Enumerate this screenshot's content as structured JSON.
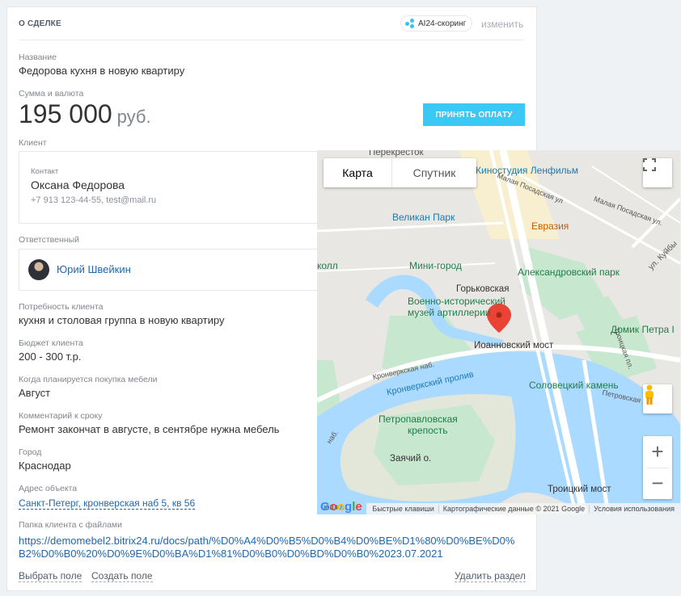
{
  "section": {
    "title": "О СДЕЛКЕ",
    "ai_badge": "AI24-скоринг",
    "edit_link": "изменить"
  },
  "deal": {
    "name_label": "Название",
    "name_value": "Федорова кухня в новую квартиру",
    "amount_label": "Сумма и валюта",
    "amount_value": "195 000",
    "currency": "руб.",
    "pay_button": "ПРИНЯТЬ ОПЛАТУ"
  },
  "client": {
    "label": "Клиент",
    "contact_label": "Контакт",
    "contact_name": "Оксана Федорова",
    "contact_info": "+7 913 123-44-55, test@mail.ru"
  },
  "responsible": {
    "label": "Ответственный",
    "name": "Юрий Швейкин"
  },
  "fields": [
    {
      "label": "Потребность клиента",
      "value": "кухня и столовая группа в новую квартиру"
    },
    {
      "label": "Бюджет клиента",
      "value": "200 - 300 т.р."
    },
    {
      "label": "Когда планируется покупка мебели",
      "value": "Август"
    },
    {
      "label": "Комментарий к сроку",
      "value": "Ремонт закончат в августе, в сентябре нужна мебель"
    },
    {
      "label": "Город",
      "value": "Краснодар"
    }
  ],
  "address": {
    "label": "Адрес объекта",
    "value": "Санкт-Петерг, кронверская наб 5, кв 56"
  },
  "folder": {
    "label": "Папка клиента с файлами",
    "value": "https://demomebel2.bitrix24.ru/docs/path/%D0%A4%D0%B5%D0%B4%D0%BE%D1%80%D0%BE%D0%B2%D0%B0%20%D0%9E%D0%BA%D1%81%D0%B0%D0%BD%D0%B0%2023.07.2021"
  },
  "footer": {
    "choose_field": "Выбрать поле",
    "create_field": "Создать поле",
    "delete_section": "Удалить раздел"
  },
  "map": {
    "type_map": "Карта",
    "type_satellite": "Спутник",
    "attrib_keys": "Быстрые клавиши",
    "attrib_data": "Картографические данные © 2021 Google",
    "attrib_terms": "Условия использования",
    "google": "Google",
    "labels": {
      "perekrestok": "Перекресток",
      "lenfilm": "Киностудия Ленфильм",
      "malaya_posad": "Малая Посадская ул",
      "malaya_posad2": "Малая Посадская ул.",
      "evraziya": "Евразия",
      "velikan": "Великан Парк",
      "mini_gorod": "Мини-город",
      "aleks_park": "Александровский парк",
      "koll": "колл",
      "ul_kuyb": "ул. Куйбы",
      "gorkovskaya": "Горьковская",
      "muzey1": "Военно-исторический",
      "muzey2": "музей артиллерии",
      "domik": "Домик Петра I",
      "ioann": "Иоанновский мост",
      "kronv_nab": "Кронверкская наб.",
      "kronv_proliv": "Кронверкский пролив",
      "solov": "Соловецкий камень",
      "troitsk_ul": "Троицкая пл.",
      "petrovsk": "Петровская наб.",
      "petropavl1": "Петропавловская",
      "petropavl2": "крепость",
      "zayachiy": "Заячий о.",
      "troitskiy": "Троицкий мост",
      "nab": "наб.",
      "yushka": "юшка"
    }
  },
  "colors": {
    "accent": "#3bc8f5",
    "link": "#2067b0",
    "map_water": "#aadaff",
    "map_park": "#c8e7cf",
    "marker": "#ea4335"
  }
}
